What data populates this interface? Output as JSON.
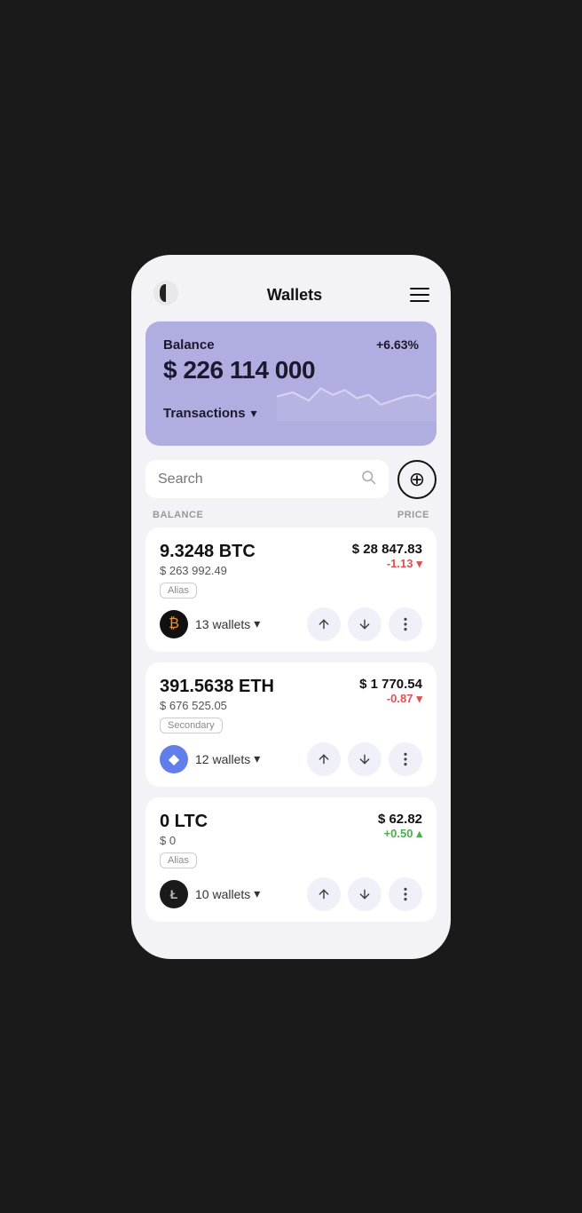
{
  "header": {
    "title": "Wallets",
    "menu_label": "menu"
  },
  "balance_card": {
    "label": "Balance",
    "percent": "+6.63%",
    "amount": "$ 226 114 000",
    "transactions_label": "Transactions"
  },
  "search": {
    "placeholder": "Search",
    "add_label": "+"
  },
  "columns": {
    "balance": "BALANCE",
    "price": "PRICE"
  },
  "coins": [
    {
      "amount": "9.3248 BTC",
      "usd": "$ 263 992.49",
      "alias": "Alias",
      "wallets": "13 wallets",
      "price": "$ 28 847.83",
      "change": "-1.13",
      "change_type": "negative",
      "symbol": "BTC"
    },
    {
      "amount": "391.5638 ETH",
      "usd": "$ 676 525.05",
      "alias": "Secondary",
      "wallets": "12 wallets",
      "price": "$ 1 770.54",
      "change": "-0.87",
      "change_type": "negative",
      "symbol": "ETH"
    },
    {
      "amount": "0 LTC",
      "usd": "$ 0",
      "alias": "Alias",
      "wallets": "10 wallets",
      "price": "$ 62.82",
      "change": "+0.50",
      "change_type": "positive",
      "symbol": "LTC"
    }
  ]
}
